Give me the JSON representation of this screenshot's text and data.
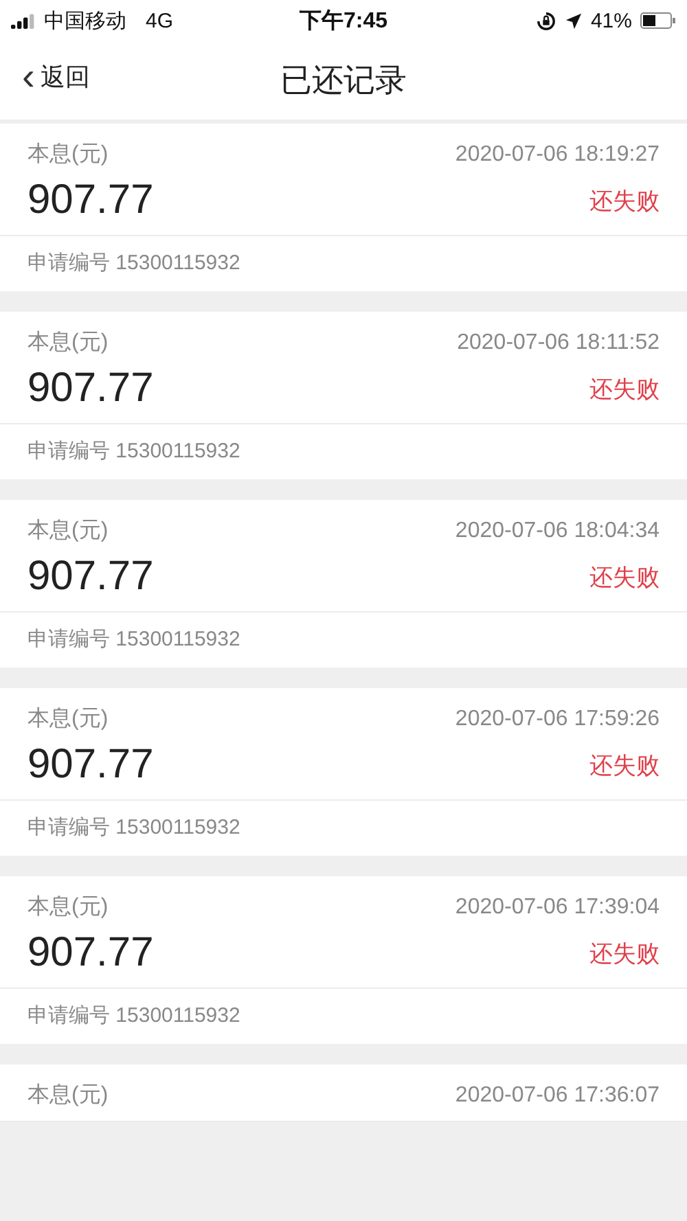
{
  "status_bar": {
    "carrier": "中国移动",
    "network": "4G",
    "time": "下午7:45",
    "battery": "41%"
  },
  "nav": {
    "back": "返回",
    "back_icon": "‹",
    "title": "已还记录"
  },
  "records": [
    {
      "label": "本息(元)",
      "time": "2020-07-06 18:19:27",
      "amount": "907.77",
      "status": "还失败",
      "id": "申请编号 15300115932"
    },
    {
      "label": "本息(元)",
      "time": "2020-07-06 18:11:52",
      "amount": "907.77",
      "status": "还失败",
      "id": "申请编号 15300115932"
    },
    {
      "label": "本息(元)",
      "time": "2020-07-06 18:04:34",
      "amount": "907.77",
      "status": "还失败",
      "id": "申请编号 15300115932"
    },
    {
      "label": "本息(元)",
      "time": "2020-07-06 17:59:26",
      "amount": "907.77",
      "status": "还失败",
      "id": "申请编号 15300115932"
    },
    {
      "label": "本息(元)",
      "time": "2020-07-06 17:39:04",
      "amount": "907.77",
      "status": "还失败",
      "id": "申请编号 15300115932"
    },
    {
      "label": "本息(元)",
      "time": "2020-07-06 17:36:07"
    }
  ]
}
